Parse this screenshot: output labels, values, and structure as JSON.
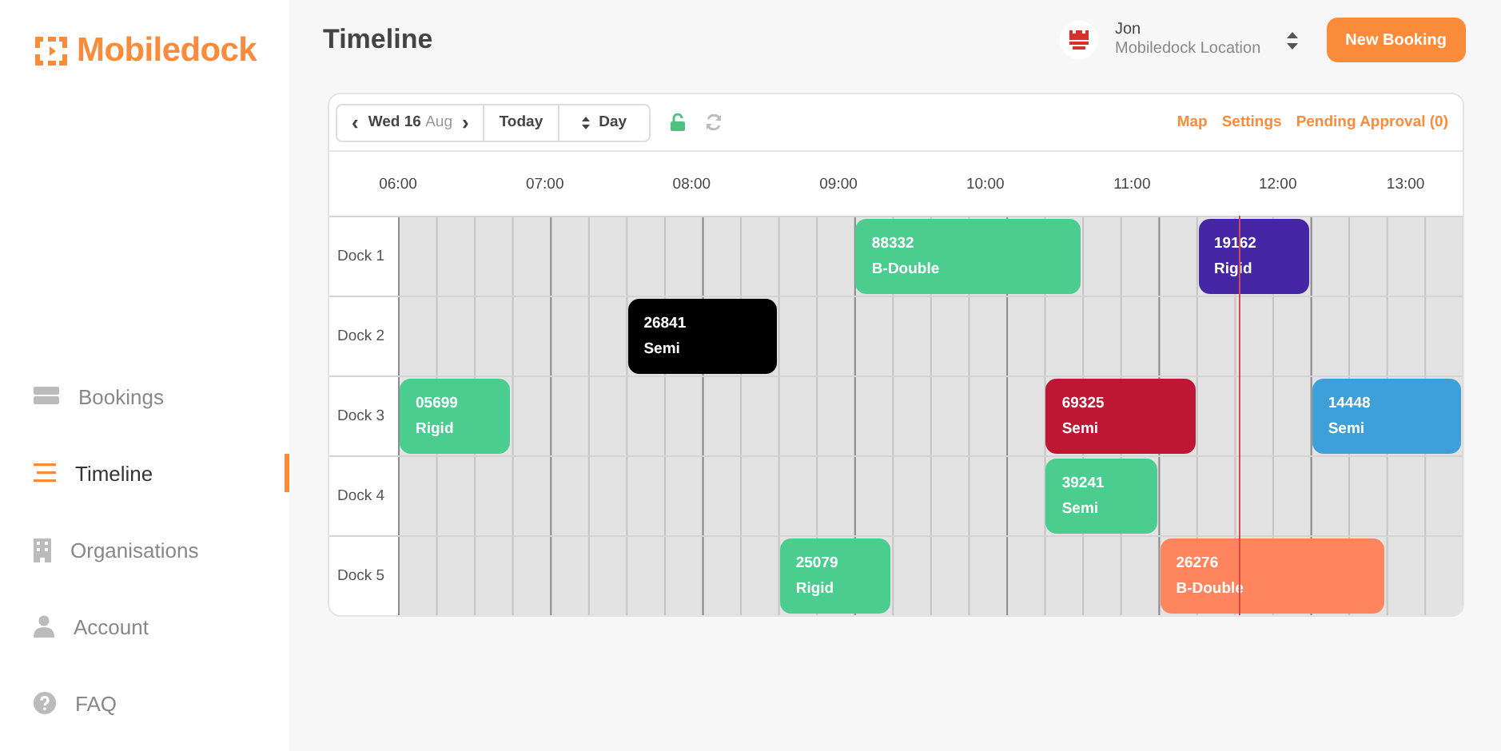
{
  "brand": {
    "name": "Mobiledock"
  },
  "sidebar": {
    "items": [
      {
        "label": "Bookings",
        "selected": false
      },
      {
        "label": "Timeline",
        "selected": true
      },
      {
        "label": "Organisations",
        "selected": false
      },
      {
        "label": "Account",
        "selected": false
      },
      {
        "label": "FAQ",
        "selected": false
      }
    ]
  },
  "header": {
    "title": "Timeline",
    "user": {
      "name": "Jon",
      "location": "Mobiledock Location"
    },
    "button": "New Booking"
  },
  "toolbar": {
    "prev": "‹",
    "date": "Wed 16",
    "month": "Aug",
    "next": "›",
    "today": "Today",
    "view": "Day",
    "locked": false,
    "links": [
      "Map",
      "Settings",
      "Pending Approval (0)"
    ]
  },
  "timeline": {
    "hours": [
      "06:00",
      "07:00",
      "08:00",
      "09:00",
      "10:00",
      "11:00",
      "12:00",
      "13:00"
    ],
    "docks": [
      {
        "label": "Dock 1",
        "bookings": [
          {
            "id": "88332",
            "type": "B-Double",
            "color": "#4ccd90"
          },
          {
            "id": "19162",
            "type": "Rigid",
            "color": "#4527a6"
          }
        ]
      },
      {
        "label": "Dock 2",
        "bookings": [
          {
            "id": "26841",
            "type": "Semi",
            "color": "#000000"
          }
        ]
      },
      {
        "label": "Dock 3",
        "bookings": [
          {
            "id": "05699",
            "type": "Rigid",
            "color": "#4ccd90"
          },
          {
            "id": "69325",
            "type": "Semi",
            "color": "#bd1733"
          },
          {
            "id": "14448",
            "type": "Semi",
            "color": "#3f9fd8"
          }
        ]
      },
      {
        "label": "Dock 4",
        "bookings": [
          {
            "id": "39241",
            "type": "Semi",
            "color": "#4ccd90"
          }
        ]
      },
      {
        "label": "Dock 5",
        "bookings": [
          {
            "id": "25079",
            "type": "Rigid",
            "color": "#4ccd90"
          },
          {
            "id": "26276",
            "type": "B-Double",
            "color": "#ff855f"
          }
        ]
      }
    ]
  }
}
